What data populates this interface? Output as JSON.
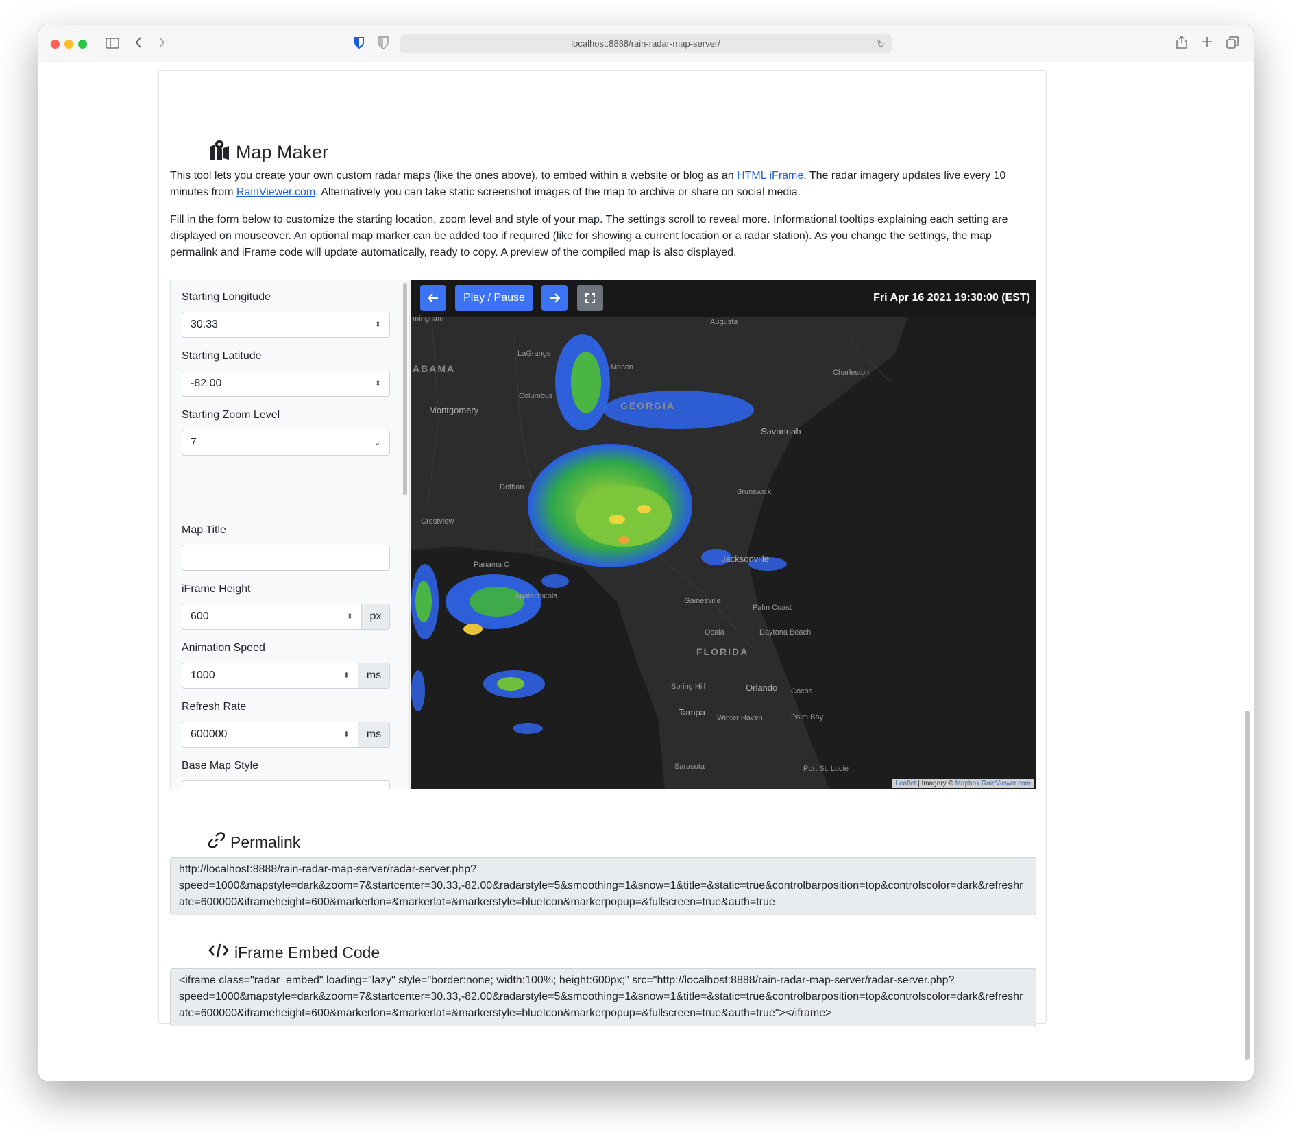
{
  "browser": {
    "url": "localhost:8888/rain-radar-map-server/"
  },
  "intro": {
    "title": "Map Maker",
    "p1_a": "This tool lets you create your own custom radar maps (like the ones above), to embed within a website or blog as an ",
    "p1_link1": "HTML iFrame",
    "p1_b": ". The radar imagery updates live every 10 minutes from ",
    "p1_link2": "RainViewer.com",
    "p1_c": ". Alternatively you can take static screenshot images of the map to archive or share on social media.",
    "p2": "Fill in the form below to customize the starting location, zoom level and style of your map. The settings scroll to reveal more. Informational tooltips explaining each setting are displayed on mouseover. An optional map marker can be added too if required (like for showing a current location or a radar station). As you change the settings, the map permalink and iFrame code will update automatically, ready to copy. A preview of the compiled map is also displayed."
  },
  "form": {
    "longitude_label": "Starting Longitude",
    "longitude_value": "30.33",
    "latitude_label": "Starting Latitude",
    "latitude_value": "-82.00",
    "zoom_label": "Starting Zoom Level",
    "zoom_value": "7",
    "title_label": "Map Title",
    "title_value": "",
    "height_label": "iFrame Height",
    "height_value": "600",
    "height_unit": "px",
    "speed_label": "Animation Speed",
    "speed_value": "1000",
    "speed_unit": "ms",
    "refresh_label": "Refresh Rate",
    "refresh_value": "600000",
    "refresh_unit": "ms",
    "basemap_label": "Base Map Style"
  },
  "map": {
    "play_label": "Play / Pause",
    "timestamp": "Fri Apr 16 2021 19:30:00 (EST)",
    "labels": {
      "mingnam": "mingnam",
      "augusta": "Augusta",
      "lagrange": "LaGrange",
      "macon": "Macon",
      "charleston": "Charleston",
      "alabama": "ABAMA",
      "columbus": "Columbus",
      "georgia": "GEORGIA",
      "montgomery": "Montgomery",
      "savannah": "Savannah",
      "dothan": "Dothan",
      "brunswick": "Brunswick",
      "crestview": "Crestview",
      "jacksonville": "Jacksonville",
      "panama": "Panama C",
      "apalachicola": "Apalachicola",
      "gainesville": "Gainesville",
      "palmcoast": "Palm Coast",
      "ocala": "Ocala",
      "daytona": "Daytona Beach",
      "florida": "FLORIDA",
      "springhill": "Spring Hill",
      "orlando": "Orlando",
      "cocoa": "Cocoa",
      "tampa": "Tampa",
      "winterhaven": "Winter Haven",
      "palmbay": "Palm Bay",
      "sarasota": "Sarasota",
      "portstlucie": "Port St. Lucie"
    },
    "attrib_leaflet": "Leaflet",
    "attrib_mid": " | Imagery © ",
    "attrib_mapbox": "Mapbox",
    "attrib_rain": "RainViewer.com"
  },
  "permalink": {
    "title": "Permalink",
    "value": "http://localhost:8888/rain-radar-map-server/radar-server.php?\nspeed=1000&mapstyle=dark&zoom=7&startcenter=30.33,-82.00&radarstyle=5&smoothing=1&snow=1&title=&static=true&controlbarposition=top&controlscolor=dark&refreshrate=600000&iframeheight=600&markerlon=&markerlat=&markerstyle=blueIcon&markerpopup=&fullscreen=true&auth=true"
  },
  "embed": {
    "title": "iFrame Embed Code",
    "value": "<iframe class=\"radar_embed\" loading=\"lazy\" style=\"border:none; width:100%; height:600px;\" src=\"http://localhost:8888/rain-radar-map-server/radar-server.php?\nspeed=1000&mapstyle=dark&zoom=7&startcenter=30.33,-82.00&radarstyle=5&smoothing=1&snow=1&title=&static=true&controlbarposition=top&controlscolor=dark&refreshrate=600000&iframeheight=600&markerlon=&markerlat=&markerstyle=blueIcon&markerpopup=&fullscreen=true&auth=true\"></iframe>"
  }
}
